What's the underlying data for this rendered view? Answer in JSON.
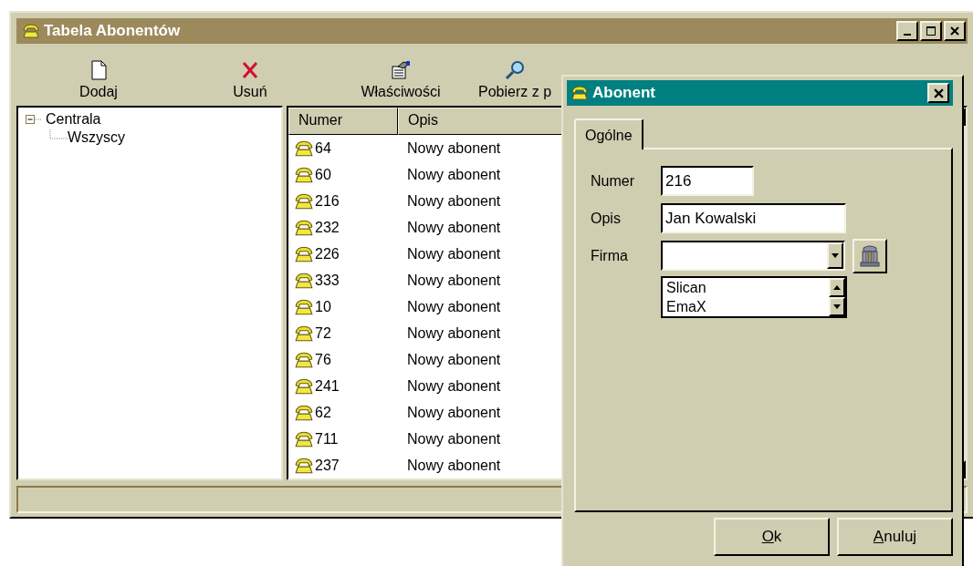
{
  "window": {
    "title": "Tabela Abonentów"
  },
  "toolbar": [
    {
      "label": "Dodaj",
      "kind": "new"
    },
    {
      "label": "Usuń",
      "kind": "delete"
    },
    {
      "label": "Właściwości",
      "kind": "properties"
    },
    {
      "label": "Pobierz z p",
      "kind": "find"
    }
  ],
  "tree": [
    {
      "label": "Centrala",
      "expanded": true,
      "children": [
        {
          "label": "Wszyscy"
        }
      ]
    }
  ],
  "table": {
    "columns": [
      "Numer",
      "Opis"
    ],
    "rows": [
      [
        "64",
        "Nowy abonent"
      ],
      [
        "60",
        "Nowy abonent"
      ],
      [
        "216",
        "Nowy abonent"
      ],
      [
        "232",
        "Nowy abonent"
      ],
      [
        "226",
        "Nowy abonent"
      ],
      [
        "333",
        "Nowy abonent"
      ],
      [
        "10",
        "Nowy abonent"
      ],
      [
        "72",
        "Nowy abonent"
      ],
      [
        "76",
        "Nowy abonent"
      ],
      [
        "241",
        "Nowy abonent"
      ],
      [
        "62",
        "Nowy abonent"
      ],
      [
        "711",
        "Nowy abonent"
      ],
      [
        "237",
        "Nowy abonent"
      ]
    ]
  },
  "dialog": {
    "title": "Abonent",
    "tabs": [
      {
        "label": "Ogólne",
        "selected": true
      }
    ],
    "fields": [
      {
        "label": "Numer",
        "kind": "text",
        "value": "216"
      },
      {
        "label": "Opis",
        "kind": "text",
        "value": "Jan Kowalski"
      },
      {
        "label": "Firma",
        "kind": "combo",
        "options": [
          "Slican",
          "EmaX"
        ]
      }
    ],
    "buttons": [
      {
        "label": "Ok",
        "first_letter_underlined": true
      },
      {
        "label": "Anuluj",
        "first_letter_underlined": true
      }
    ]
  }
}
